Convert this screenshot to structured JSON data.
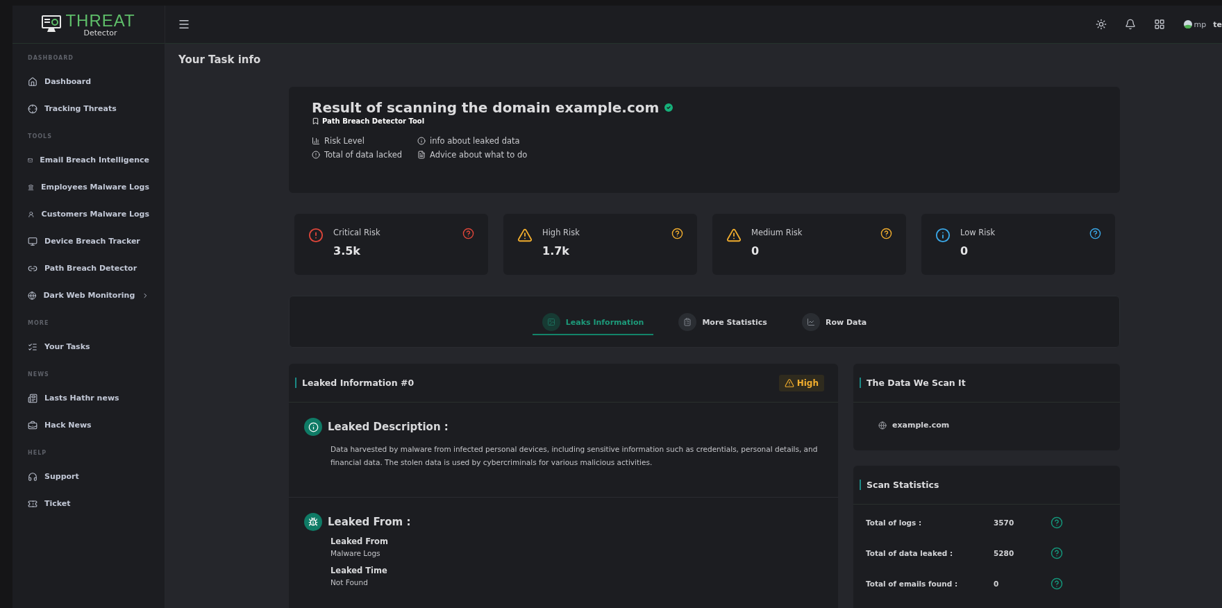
{
  "sidebar": {
    "logo": {
      "title": "THREAT",
      "subtitle": "Detector"
    },
    "sections": [
      {
        "heading": "DASHBOARD",
        "items": [
          {
            "label": "Dashboard",
            "has_submenu": false
          },
          {
            "label": "Tracking Threats",
            "has_submenu": false
          }
        ]
      },
      {
        "heading": "TOOLS",
        "items": [
          {
            "label": "Email Breach Intelligence",
            "has_submenu": false
          },
          {
            "label": "Employees Malware Logs",
            "has_submenu": false
          },
          {
            "label": "Customers Malware Logs",
            "has_submenu": false
          },
          {
            "label": "Device Breach Tracker",
            "has_submenu": false
          },
          {
            "label": "Path Breach Detector",
            "has_submenu": false
          },
          {
            "label": "Dark Web Monitoring",
            "has_submenu": true
          }
        ]
      },
      {
        "heading": "MORE",
        "items": [
          {
            "label": "Your Tasks",
            "has_submenu": false
          }
        ]
      },
      {
        "heading": "NEWS",
        "items": [
          {
            "label": "Lasts Hathr news",
            "has_submenu": false
          },
          {
            "label": "Hack News",
            "has_submenu": false
          }
        ]
      },
      {
        "heading": "HELP",
        "items": [
          {
            "label": "Support",
            "has_submenu": false
          },
          {
            "label": "Ticket",
            "has_submenu": false
          }
        ]
      }
    ]
  },
  "topbar": {
    "avatar_alt": "mp",
    "user": "te"
  },
  "page_title": "Your Task info",
  "result": {
    "title": "Result of scanning the domain example.com",
    "verified": true,
    "tool": "Path Breach Detector Tool",
    "legend": [
      {
        "label": "Risk Level"
      },
      {
        "label": "info about leaked data"
      },
      {
        "label": "Total of data lacked"
      },
      {
        "label": "Advice about what to do"
      }
    ]
  },
  "risk_cards": [
    {
      "label": "Critical Risk",
      "value": "3.5k",
      "kind": "critical",
      "color": "#e0463a"
    },
    {
      "label": "High Risk",
      "value": "1.7k",
      "kind": "warning",
      "color": "#f0ad2e"
    },
    {
      "label": "Medium Risk",
      "value": "0",
      "kind": "warning",
      "color": "#f0ad2e"
    },
    {
      "label": "Low Risk",
      "value": "0",
      "kind": "info",
      "color": "#3aa8e8"
    }
  ],
  "tabs": [
    {
      "label": "Leaks Information",
      "selected": true
    },
    {
      "label": "More Statistics",
      "selected": false
    },
    {
      "label": "Row Data",
      "selected": false
    }
  ],
  "leak": {
    "title": "Leaked Information #0",
    "badge": "High",
    "description_heading": "Leaked Description :",
    "description": "Data harvested by malware from infected personal devices, including sensitive information such as credentials, personal details, and financial data. The stolen data is used by cybercriminals for various malicious activities.",
    "from_heading": "Leaked From :",
    "fields": [
      {
        "label": "Leaked From",
        "value": "Malware Logs"
      },
      {
        "label": "Leaked Time",
        "value": "Not Found"
      }
    ]
  },
  "scanned": {
    "title": "The Data We Scan It",
    "domain": "example.com"
  },
  "stats": {
    "title": "Scan Statistics",
    "rows": [
      {
        "label": "Total of logs :",
        "value": "3570"
      },
      {
        "label": "Total of data leaked :",
        "value": "5280"
      },
      {
        "label": "Total of emails found :",
        "value": "0"
      }
    ]
  }
}
